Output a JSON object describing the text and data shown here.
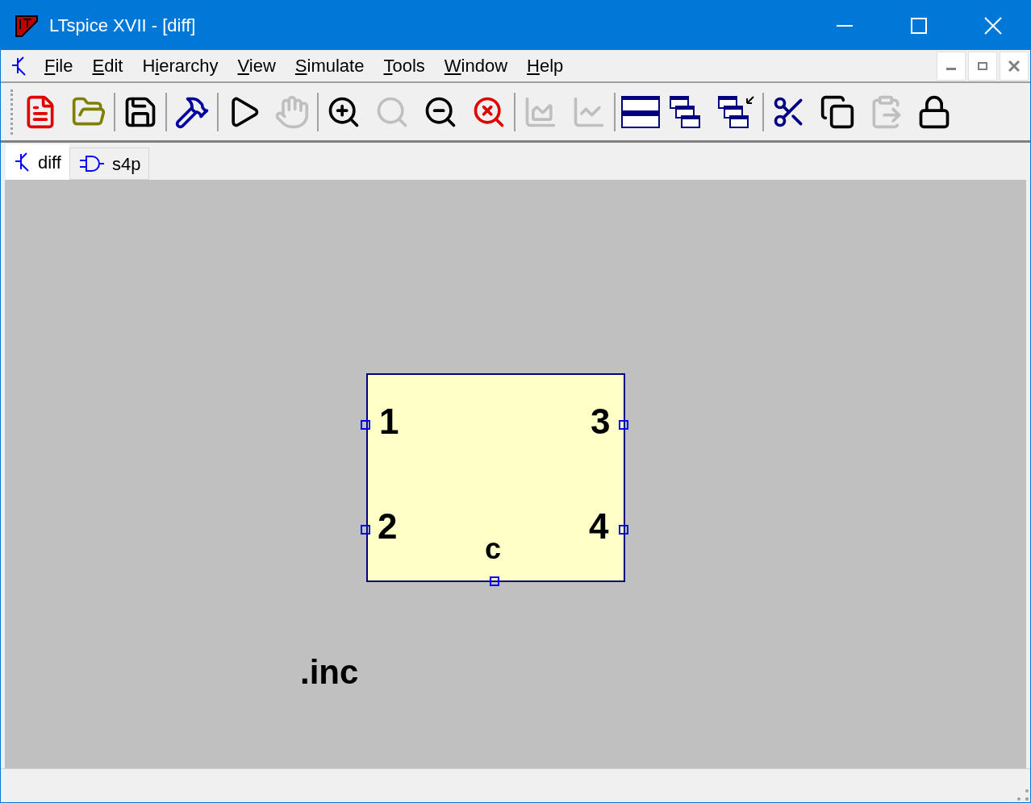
{
  "window": {
    "title": "LTspice XVII - [diff]"
  },
  "menu": [
    {
      "access_key": "F",
      "label_rest": "ile"
    },
    {
      "access_key": "E",
      "label_rest": "dit"
    },
    {
      "label_start": "H",
      "access_key": "i",
      "label_rest": "erarchy"
    },
    {
      "access_key": "V",
      "label_rest": "iew"
    },
    {
      "access_key": "S",
      "label_rest": "imulate"
    },
    {
      "access_key": "T",
      "label_rest": "ools"
    },
    {
      "access_key": "W",
      "label_rest": "indow"
    },
    {
      "access_key": "H",
      "label_rest": "elp"
    }
  ],
  "toolbar": [
    [
      {
        "kind": "new",
        "disabled": false
      },
      {
        "kind": "open",
        "disabled": false
      }
    ],
    [
      {
        "kind": "save",
        "disabled": false
      }
    ],
    [
      {
        "kind": "settings",
        "disabled": false
      }
    ],
    [
      {
        "kind": "run",
        "disabled": false
      },
      {
        "kind": "halt",
        "disabled": true
      }
    ],
    [
      {
        "kind": "zoom-in",
        "disabled": false
      },
      {
        "kind": "zoom",
        "disabled": true
      },
      {
        "kind": "zoom-out",
        "disabled": false
      },
      {
        "kind": "zoom-cancel",
        "disabled": false
      }
    ],
    [
      {
        "kind": "plot",
        "disabled": true
      },
      {
        "kind": "bode",
        "disabled": true
      }
    ],
    [
      {
        "kind": "tile",
        "disabled": false
      },
      {
        "kind": "cascade",
        "disabled": false
      },
      {
        "kind": "cascade-arrow",
        "disabled": false
      }
    ],
    [
      {
        "kind": "cut",
        "disabled": false
      },
      {
        "kind": "copy",
        "disabled": false
      },
      {
        "kind": "paste",
        "disabled": true
      },
      {
        "kind": "lock",
        "disabled": false
      }
    ]
  ],
  "tabs": [
    {
      "label": "diff",
      "kind": "schematic",
      "selected": true
    },
    {
      "label": "s4p",
      "kind": "symbol",
      "selected": false
    }
  ],
  "symbol": {
    "pins": [
      "1",
      "2",
      "3",
      "4"
    ],
    "label": "c"
  },
  "directive": ".inc"
}
